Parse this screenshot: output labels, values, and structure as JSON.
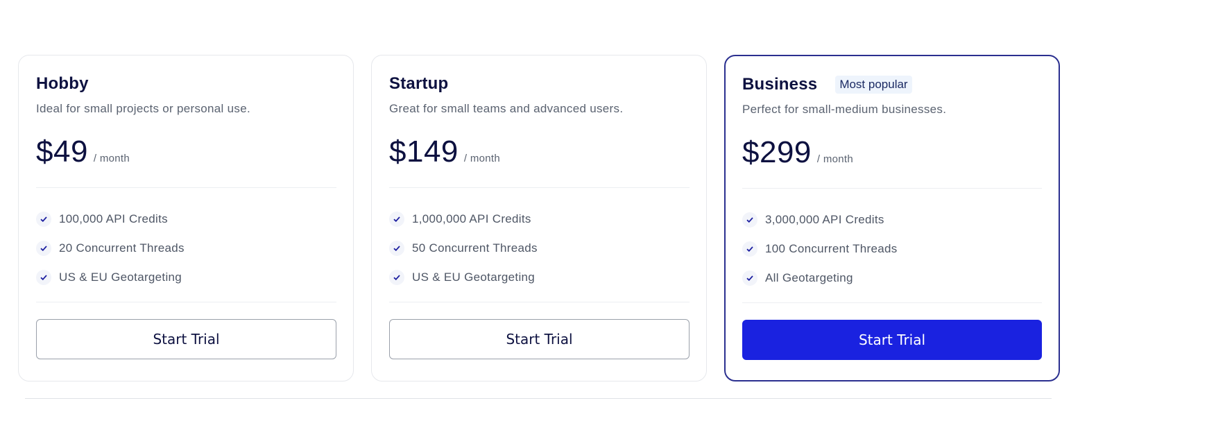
{
  "plans": [
    {
      "name": "Hobby",
      "badge": null,
      "description": "Ideal for small projects or personal use.",
      "price": "$49",
      "period": "/ month",
      "features": [
        "100,000 API Credits",
        "20 Concurrent Threads",
        "US & EU Geotargeting"
      ],
      "cta": "Start Trial"
    },
    {
      "name": "Startup",
      "badge": null,
      "description": "Great for small teams and advanced users.",
      "price": "$149",
      "period": "/ month",
      "features": [
        "1,000,000 API Credits",
        "50 Concurrent Threads",
        "US & EU Geotargeting"
      ],
      "cta": "Start Trial"
    },
    {
      "name": "Business",
      "badge": "Most popular",
      "description": "Perfect for small-medium businesses.",
      "price": "$299",
      "period": "/ month",
      "features": [
        "3,000,000 API Credits",
        "100 Concurrent Threads",
        "All Geotargeting"
      ],
      "cta": "Start Trial"
    }
  ],
  "icons": {
    "feature": "check-icon"
  },
  "colors": {
    "accent": "#1a22e0",
    "featured_border": "#2a2f8f",
    "heading": "#0d1140",
    "muted": "#5a6270"
  }
}
